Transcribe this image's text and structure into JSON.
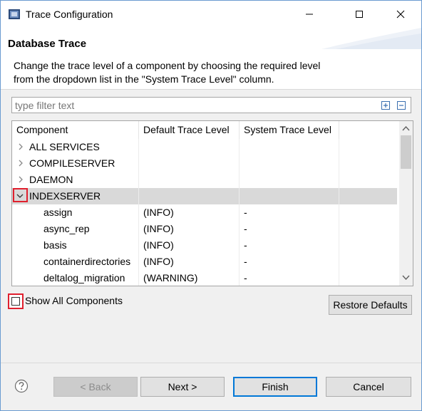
{
  "window": {
    "title": "Trace Configuration"
  },
  "banner": {
    "title": "Database Trace",
    "description": "Change the trace level of a component by choosing the required level from the dropdown list in the \"System Trace Level\" column."
  },
  "filter": {
    "placeholder": "type filter text",
    "value": ""
  },
  "table": {
    "columns": [
      "Component",
      "Default Trace Level",
      "System Trace Level"
    ],
    "rows": [
      {
        "component": "ALL SERVICES",
        "level": 0,
        "expander": "collapsed",
        "default": "",
        "system": ""
      },
      {
        "component": "COMPILESERVER",
        "level": 0,
        "expander": "collapsed",
        "default": "",
        "system": ""
      },
      {
        "component": "DAEMON",
        "level": 0,
        "expander": "collapsed",
        "default": "",
        "system": ""
      },
      {
        "component": "INDEXSERVER",
        "level": 0,
        "expander": "expanded",
        "default": "",
        "system": "",
        "selected": true
      },
      {
        "component": "assign",
        "level": 1,
        "expander": "none",
        "default": "(INFO)",
        "system": "-"
      },
      {
        "component": "async_rep",
        "level": 1,
        "expander": "none",
        "default": "(INFO)",
        "system": "-"
      },
      {
        "component": "basis",
        "level": 1,
        "expander": "none",
        "default": "(INFO)",
        "system": "-"
      },
      {
        "component": "containerdirectories",
        "level": 1,
        "expander": "none",
        "default": "(INFO)",
        "system": "-"
      },
      {
        "component": "deltalog_migration",
        "level": 1,
        "expander": "none",
        "default": "(WARNING)",
        "system": "-"
      }
    ]
  },
  "options": {
    "show_all_label": "Show All Components",
    "show_all_checked": false,
    "restore_defaults_label": "Restore Defaults"
  },
  "footer": {
    "back_label": "< Back",
    "next_label": "Next >",
    "finish_label": "Finish",
    "cancel_label": "Cancel"
  },
  "colors": {
    "highlight": "#e0202e",
    "selected_row": "#d9d9d9",
    "default_button_border": "#0078d7"
  }
}
